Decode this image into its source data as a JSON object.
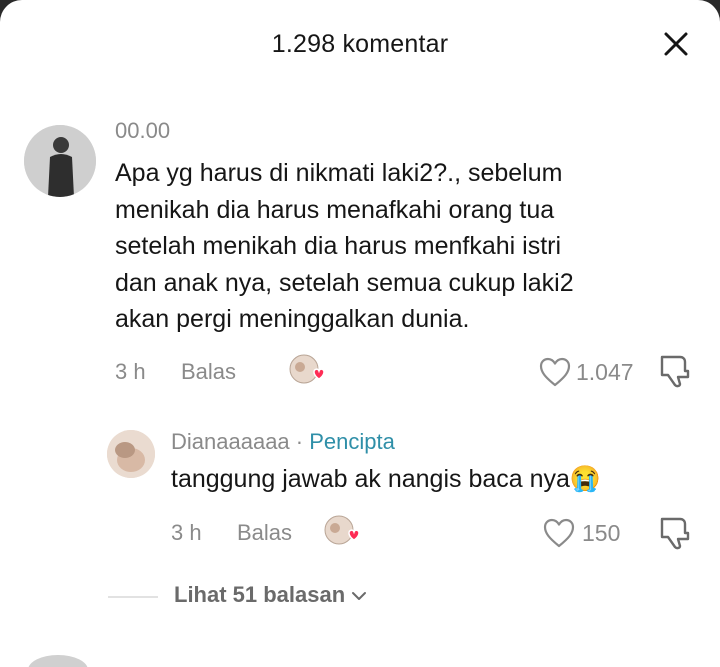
{
  "header": {
    "title": "1.298 komentar"
  },
  "comment": {
    "username": "00.00",
    "text_lines": [
      "Apa yg harus di nikmati laki2?., sebelum",
      "menikah dia harus menafkahi orang tua",
      "setelah menikah dia harus menfkahi istri",
      "dan anak nya, setelah semua cukup laki2",
      "akan pergi meninggalkan dunia."
    ],
    "time": "3 h",
    "reply_label": "Balas",
    "likes": "1.047"
  },
  "reply": {
    "username": "Dianaaaaaa",
    "separator": "·",
    "creator_label": "Pencipta",
    "text": "tanggung jawab ak nangis baca nya",
    "emoji": "😭",
    "time": "3 h",
    "reply_label": "Balas",
    "likes": "150"
  },
  "view_replies": {
    "label": "Lihat 51 balasan"
  }
}
